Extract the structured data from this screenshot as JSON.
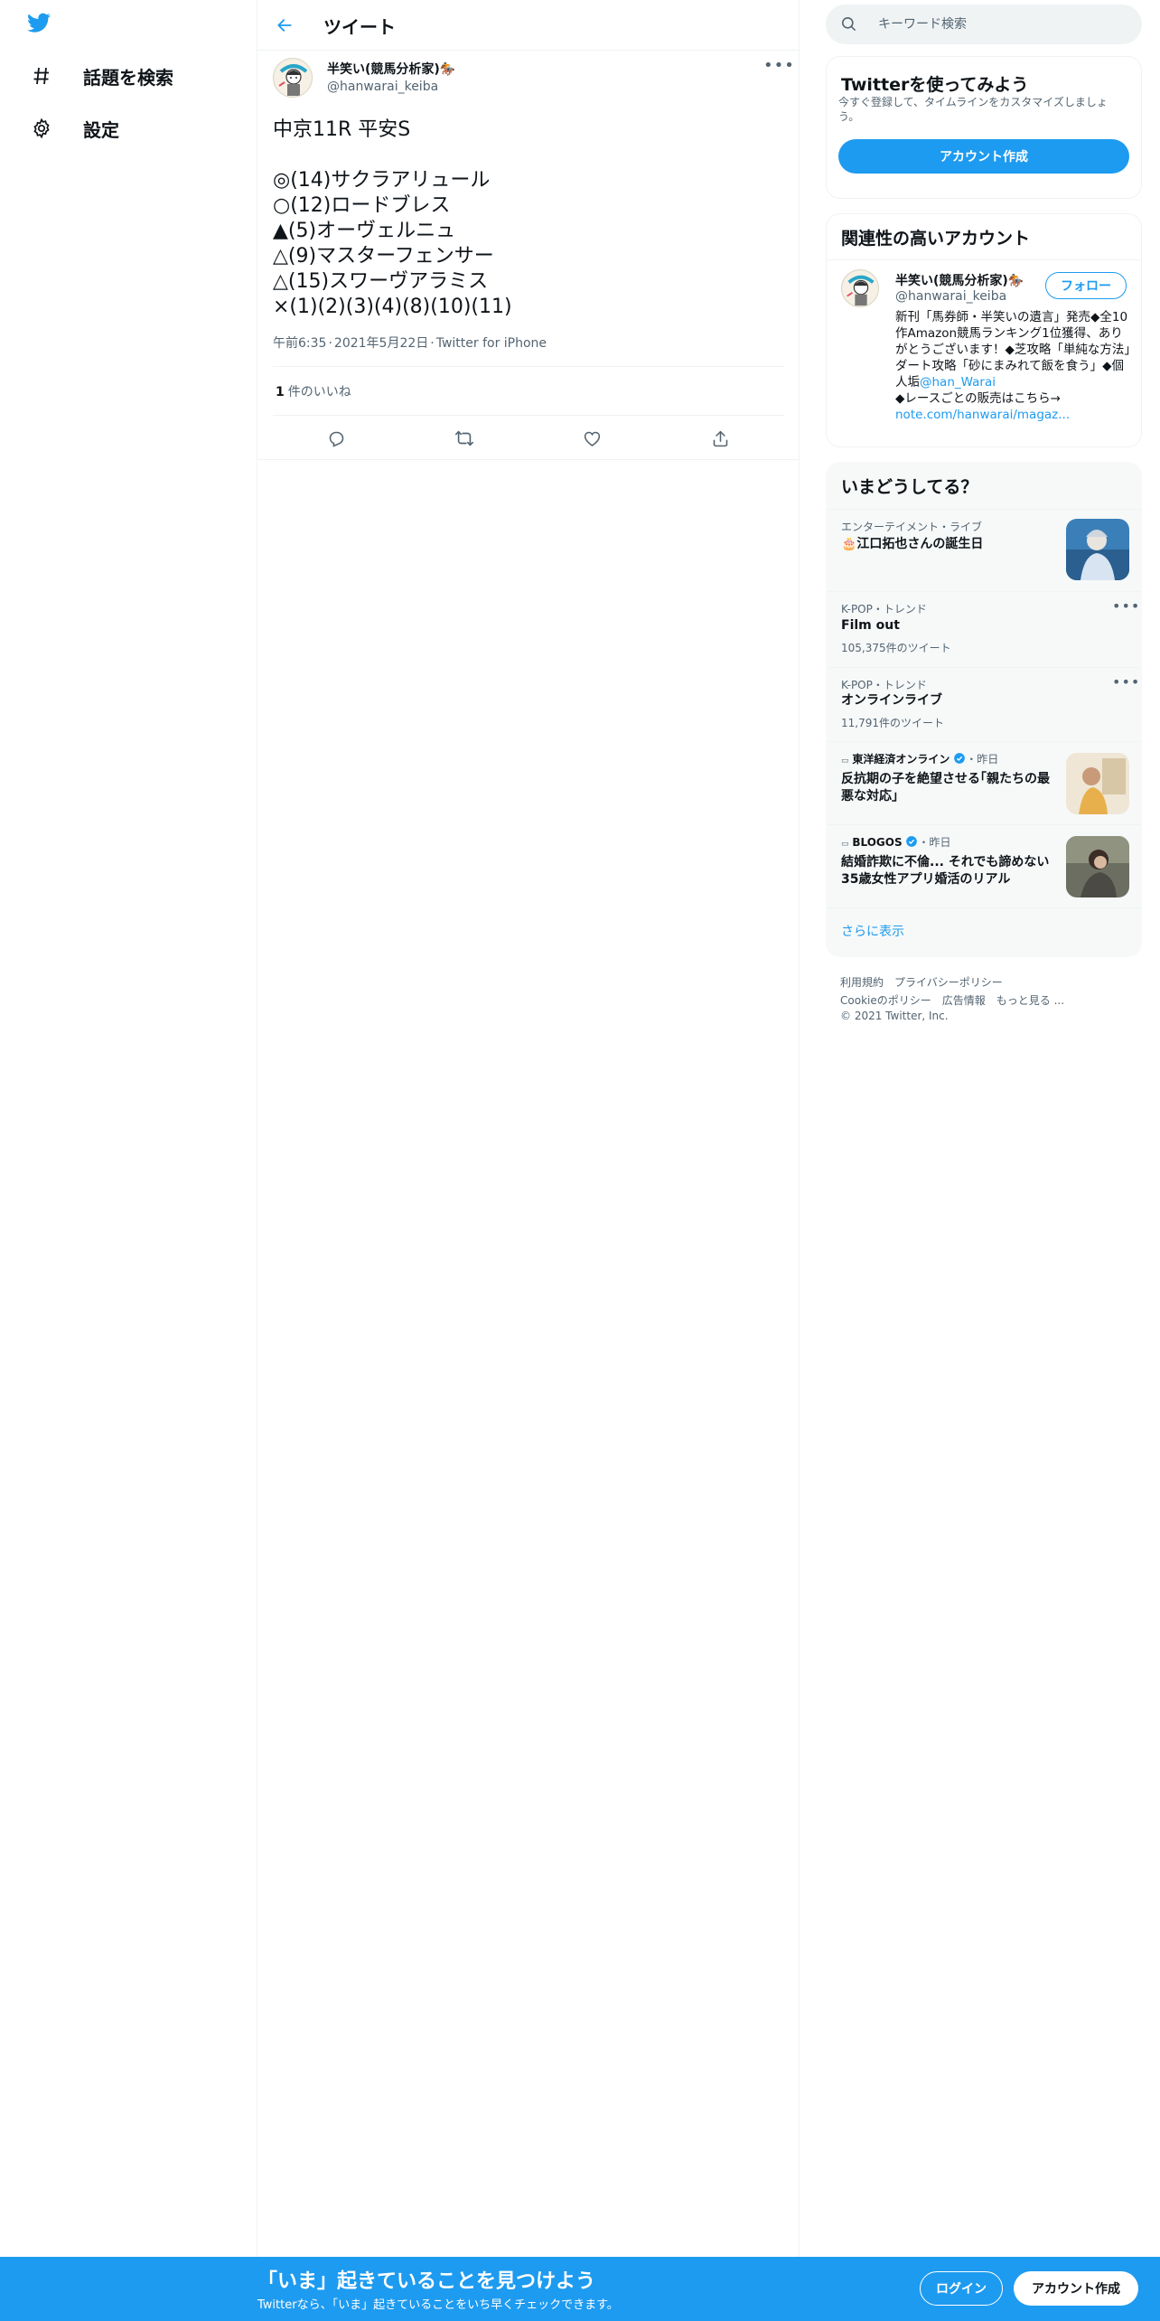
{
  "nav": {
    "explore_label": "話題を検索",
    "settings_label": "設定"
  },
  "header": {
    "title": "ツイート"
  },
  "tweet": {
    "author_name": "半笑い(競馬分析家)🏇",
    "author_handle": "@hanwarai_keiba",
    "text": "中京11R 平安S\n\n◎(14)サクラアリュール\n○(12)ロードブレス\n▲(5)オーヴェルニュ\n△(9)マスターフェンサー\n△(15)スワーヴアラミス\n×(1)(2)(3)(4)(8)(10)(11)",
    "time": "午前6:35",
    "date": "2021年5月22日",
    "source": "Twitter for iPhone",
    "like_count": "1",
    "like_label": "件のいいね"
  },
  "search": {
    "placeholder": "キーワード検索"
  },
  "signup_card": {
    "title": "Twitterを使ってみよう",
    "description": "今すぐ登録して、タイムラインをカスタマイズしましょう。",
    "button": "アカウント作成"
  },
  "related": {
    "title": "関連性の高いアカウント",
    "name": "半笑い(競馬分析家)🏇",
    "handle": "@hanwarai_keiba",
    "follow": "フォロー",
    "bio_text": "新刊「馬券師・半笑いの遺言」発売◆全10作Amazon競馬ランキング1位獲得、ありがとうございます！◆芝攻略「単純な方法」ダート攻略「砂にまみれて飯を食う」◆個人垢",
    "bio_mention": "@han_Warai",
    "bio_text2": "◆レースごとの販売はこちら→",
    "bio_link": "note.com/hanwarai/magaz..."
  },
  "trends": {
    "title": "いまどうしてる？",
    "items": [
      {
        "meta": "エンターテイメント・ライブ",
        "title": "🎂江口拓也さんの誕生日"
      },
      {
        "meta": "K-POP・トレンド",
        "title": "Film out",
        "count": "105,375件のツイート"
      },
      {
        "meta": "K-POP・トレンド",
        "title": "オンラインライブ",
        "count": "11,791件のツイート"
      },
      {
        "meta_source": "東洋経済オンライン",
        "meta_time": "・昨日",
        "title": "反抗期の子を絶望させる｢親たちの最悪な対応｣"
      },
      {
        "meta_source": "BLOGOS",
        "meta_time": "・昨日",
        "title": "結婚詐欺に不倫... それでも諦めない35歳女性アプリ婚活のリアル"
      }
    ],
    "show_more": "さらに表示"
  },
  "footer": {
    "links": [
      "利用規約",
      "プライバシーポリシー",
      "Cookieのポリシー",
      "広告情報",
      "もっと見る ..."
    ],
    "copyright": "© 2021 Twitter, Inc."
  },
  "banner": {
    "title": "「いま」起きていることを見つけよう",
    "subtitle": "Twitterなら、「いま」起きていることをいち早くチェックできます。",
    "login": "ログイン",
    "signup": "アカウント作成"
  },
  "colors": {
    "accent": "#1d9bf0",
    "text": "#0f1419",
    "secondary": "#536471"
  }
}
